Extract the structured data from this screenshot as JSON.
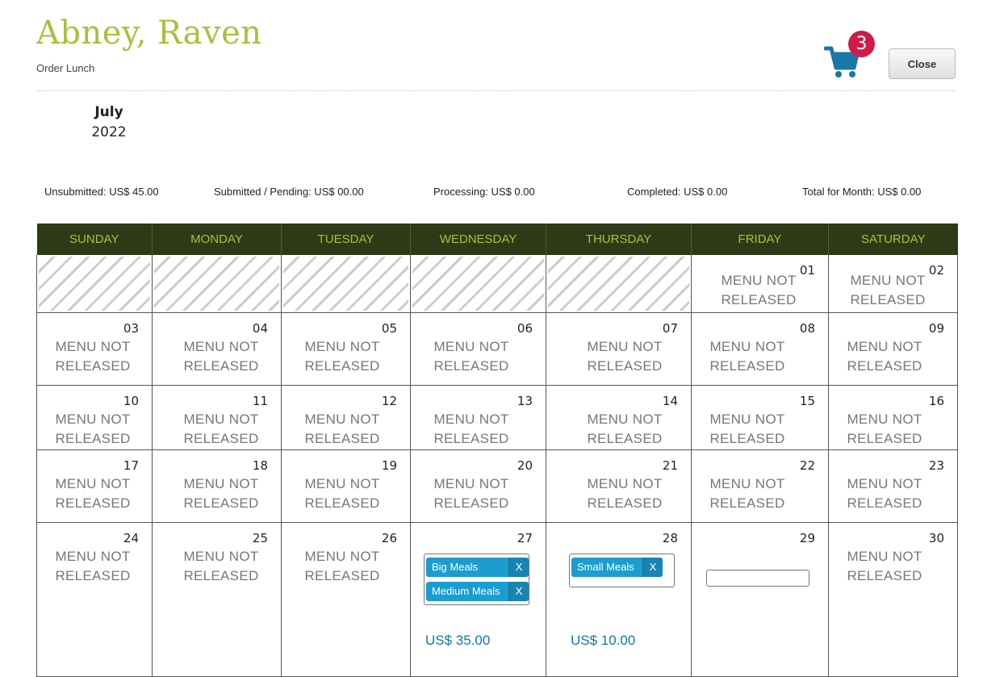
{
  "header": {
    "name": "Abney, Raven",
    "subtitle": "Order Lunch",
    "cart_count": "3",
    "close_label": "Close"
  },
  "period": {
    "month": "July",
    "year": "2022"
  },
  "totals": {
    "unsubmitted": "Unsubmitted: US$ 45.00",
    "submitted": "Submitted / Pending: US$ 00.00",
    "processing": "Processing: US$ 0.00",
    "completed": "Completed: US$ 0.00",
    "total": "Total for Month: US$ 0.00"
  },
  "weekdays": [
    "SUNDAY",
    "MONDAY",
    "TUESDAY",
    "WEDNESDAY",
    "THURSDAY",
    "FRIDAY",
    "SATURDAY"
  ],
  "mnr_line1": "MENU NOT",
  "mnr_line2": "RELEASED",
  "days": {
    "d01": "01",
    "d02": "02",
    "d03": "03",
    "d04": "04",
    "d05": "05",
    "d06": "06",
    "d07": "07",
    "d08": "08",
    "d09": "09",
    "d10": "10",
    "d11": "11",
    "d12": "12",
    "d13": "13",
    "d14": "14",
    "d15": "15",
    "d16": "16",
    "d17": "17",
    "d18": "18",
    "d19": "19",
    "d20": "20",
    "d21": "21",
    "d22": "22",
    "d23": "23",
    "d24": "24",
    "d25": "25",
    "d26": "26",
    "d27": "27",
    "d28": "28",
    "d29": "29",
    "d30": "30"
  },
  "day27": {
    "meals": [
      "Big Meals",
      "Medium Meals"
    ],
    "price": "US$ 35.00"
  },
  "day28": {
    "meals": [
      "Small Meals"
    ],
    "price": "US$ 10.00"
  },
  "remove_label": "X",
  "colors": {
    "accent": "#a5c23a",
    "header_bg": "#2e3a17",
    "tag": "#1c9ccf",
    "badge": "#d01b48",
    "price": "#1475a8"
  }
}
